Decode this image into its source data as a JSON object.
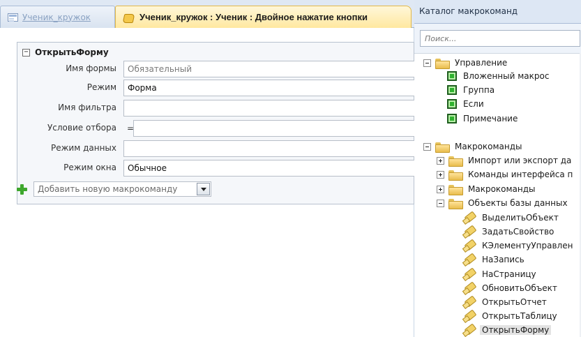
{
  "tabs": [
    {
      "label": "Ученик_кружок",
      "active": false
    },
    {
      "label": "Ученик_кружок : Ученик : Двойное нажатие кнопки",
      "active": true
    }
  ],
  "action": {
    "title": "ОткрытьФорму",
    "collapse_glyph": "−",
    "arguments": [
      {
        "label": "Имя формы",
        "value": "Обязательный",
        "is_placeholder": true
      },
      {
        "label": "Режим",
        "value": "Форма"
      },
      {
        "label": "Имя фильтра",
        "value": ""
      },
      {
        "label": "Условие отбора",
        "prefix": "=",
        "value": ""
      },
      {
        "label": "Режим данных",
        "value": ""
      },
      {
        "label": "Режим окна",
        "value": "Обычное"
      }
    ]
  },
  "add_action": {
    "placeholder": "Добавить новую макрокоманду"
  },
  "catalog": {
    "title": "Каталог макрокоманд",
    "search_placeholder": "Поиск...",
    "groups": [
      {
        "label": "Управление",
        "items": [
          "Вложенный макрос",
          "Группа",
          "Если",
          "Примечание"
        ]
      },
      {
        "label": "Макрокоманды",
        "subgroups": [
          {
            "label": "Импорт или экспорт да",
            "expanded": false
          },
          {
            "label": "Команды интерфейса п",
            "expanded": false
          },
          {
            "label": "Макрокоманды",
            "expanded": false
          },
          {
            "label": "Объекты базы данных",
            "expanded": true,
            "items": [
              "ВыделитьОбъект",
              "ЗадатьСвойство",
              "КЭлементуУправлен",
              "НаЗапись",
              "НаСтраницу",
              "ОбновитьОбъект",
              "ОткрытьОтчет",
              "ОткрытьТаблицу",
              "ОткрытьФорму"
            ]
          }
        ]
      }
    ],
    "selected_item": "ОткрытьФорму"
  }
}
